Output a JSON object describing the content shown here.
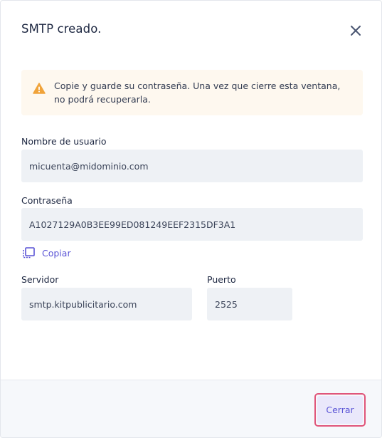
{
  "modal": {
    "title": "SMTP creado.",
    "close_icon": "close-icon"
  },
  "alert": {
    "icon": "warning-icon",
    "text": "Copie y guarde su contraseña. Una vez que cierre esta ventana, no podrá recuperarla.",
    "background": "#fef8ef",
    "icon_color": "#f0a33a"
  },
  "username": {
    "label": "Nombre de usuario",
    "value": "micuenta@midominio.com"
  },
  "password": {
    "label": "Contraseña",
    "value": "A1027129A0B3EE99ED081249EEF2315DF3A1"
  },
  "copy": {
    "icon": "copy-icon",
    "label": "Copiar"
  },
  "server": {
    "label": "Servidor",
    "value": "smtp.kitpublicitario.com"
  },
  "port": {
    "label": "Puerto",
    "value": "2525"
  },
  "footer": {
    "close_button_label": "Cerrar"
  },
  "colors": {
    "accent": "#5b55d6",
    "focus_ring": "#e0557a",
    "field_bg": "#eef1f5"
  }
}
